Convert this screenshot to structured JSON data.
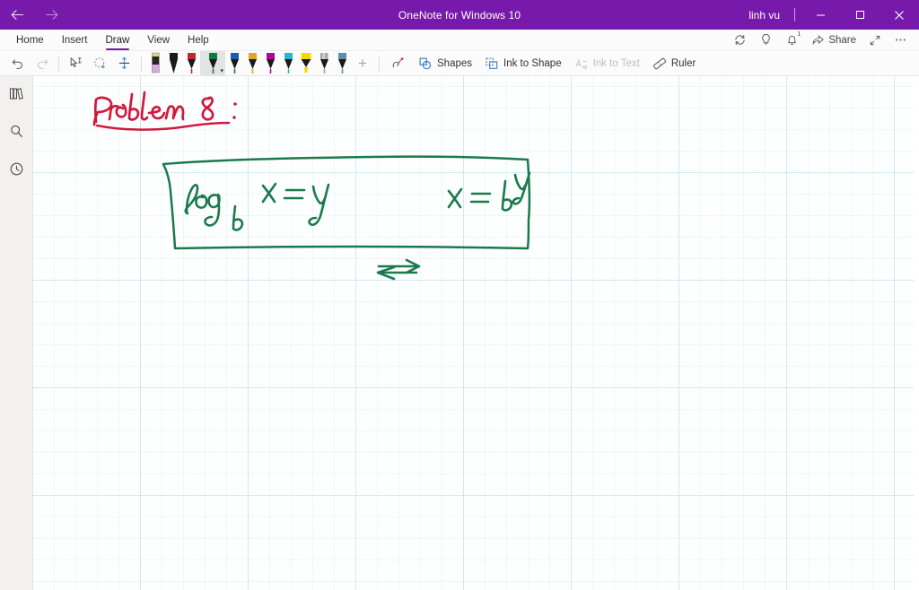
{
  "window": {
    "title": "OneNote for Windows 10",
    "user": "linh vu",
    "accent_color": "#7719aa",
    "back_icon": "arrow-left-icon",
    "forward_icon": "arrow-right-icon",
    "minimize_label": "–",
    "maximize_label": "❐",
    "close_label": "✕"
  },
  "ribbon": {
    "tabs": [
      {
        "label": "Home",
        "active": false
      },
      {
        "label": "Insert",
        "active": false
      },
      {
        "label": "Draw",
        "active": true
      },
      {
        "label": "View",
        "active": false
      },
      {
        "label": "Help",
        "active": false
      }
    ],
    "right_items": [
      {
        "label": "",
        "icon": "sync-icon"
      },
      {
        "label": "",
        "icon": "lightbulb-icon"
      },
      {
        "label": "",
        "icon": "bell-icon",
        "badge": "1"
      },
      {
        "label": "Share",
        "icon": "share-icon"
      },
      {
        "label": "",
        "icon": "expand-icon"
      },
      {
        "label": "",
        "icon": "ellipsis-icon"
      }
    ]
  },
  "drawbar": {
    "undo_label": "Undo",
    "redo_label": "Redo",
    "tools_left": [
      {
        "name": "lasso-select-icon",
        "enabled": true
      },
      {
        "name": "ink-eraser-select-icon",
        "enabled": true
      },
      {
        "name": "insert-space-icon",
        "enabled": true
      }
    ],
    "pens": [
      {
        "name": "eraser",
        "color": "#d9a9dd",
        "tip": "#2b2b2b",
        "cap": "#d8d07a",
        "selected": false,
        "type": "eraser"
      },
      {
        "name": "pen-black",
        "color": "#1a1a1a",
        "cap": "#1a1a1a",
        "selected": false,
        "type": "pen"
      },
      {
        "name": "pen-red",
        "color": "#c4262c",
        "cap": "#c4262c",
        "selected": false,
        "type": "pen"
      },
      {
        "name": "pen-green",
        "color": "#107c41",
        "cap": "#107c41",
        "selected": true,
        "type": "pen"
      },
      {
        "name": "pen-blue",
        "color": "#1a5fa8",
        "cap": "#1a5fa8",
        "selected": false,
        "type": "pen"
      },
      {
        "name": "pen-gold",
        "color": "#e0a526",
        "cap": "#e0a526",
        "selected": false,
        "type": "pen"
      },
      {
        "name": "pen-magenta",
        "color": "#b4009e",
        "cap": "#b4009e",
        "selected": false,
        "type": "pen"
      },
      {
        "name": "pen-cyan",
        "color": "#2bb3d6",
        "cap": "#2bb3d6",
        "selected": false,
        "type": "pen"
      },
      {
        "name": "highlighter-yellow",
        "color": "#f5d800",
        "cap": "#f5d800",
        "selected": false,
        "type": "highlighter"
      },
      {
        "name": "pen-silver",
        "color": "#9aa0a6",
        "cap": "#c8cdd2",
        "selected": false,
        "type": "pen"
      },
      {
        "name": "pen-steel",
        "color": "#5b8ca8",
        "cap": "#5b8ca8",
        "selected": false,
        "type": "pen"
      }
    ],
    "add_pen_label": "+",
    "tools_right": [
      {
        "label": "",
        "icon": "ink-effects-icon",
        "enabled": true
      },
      {
        "label": "Shapes",
        "icon": "shapes-icon",
        "enabled": true
      },
      {
        "label": "Ink to Shape",
        "icon": "ink-to-shape-icon",
        "enabled": true
      },
      {
        "label": "Ink to Text",
        "icon": "ink-to-text-icon",
        "enabled": false
      },
      {
        "label": "Ruler",
        "icon": "ruler-icon",
        "enabled": true
      }
    ]
  },
  "rail": {
    "items": [
      {
        "name": "notebooks-icon",
        "label": "Notebooks"
      },
      {
        "name": "search-icon",
        "label": "Search"
      },
      {
        "name": "recent-notes-icon",
        "label": "Recent Notes"
      }
    ]
  },
  "canvas": {
    "grid_color": "#96c3d4",
    "background": "#fdffff",
    "ink_notes": [
      {
        "name": "problem-heading",
        "text": "Problem 8 :",
        "color": "#d1193e",
        "underlined": true
      },
      {
        "name": "boxed-equation",
        "text": "log_b x = y  ⟺  x = b^y",
        "color": "#1b7a4b",
        "boxed": true,
        "parts": [
          "log",
          "b",
          "x = y",
          "⟺",
          "x =",
          "b",
          "y"
        ]
      }
    ]
  }
}
